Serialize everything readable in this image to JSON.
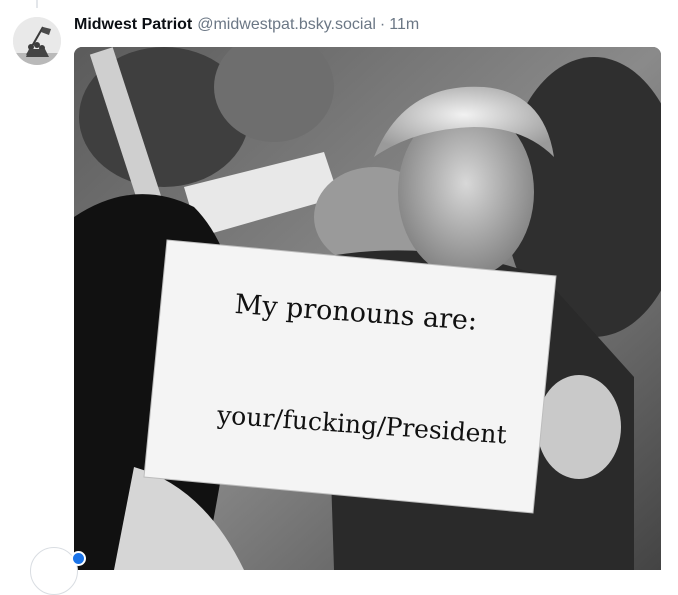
{
  "post": {
    "author_name": "Midwest Patriot",
    "author_handle": "@midwestpat.bsky.social",
    "separator": "·",
    "time": "11m",
    "avatar_icon": "iwo-jima-flag-raising-avatar"
  },
  "image": {
    "sign_line_1": "My pronouns are:",
    "sign_line_2": "your/fucking/President"
  },
  "colors": {
    "author_name": "#0b0f14",
    "muted": "#6b7785",
    "status_dot": "#1a73e8"
  }
}
